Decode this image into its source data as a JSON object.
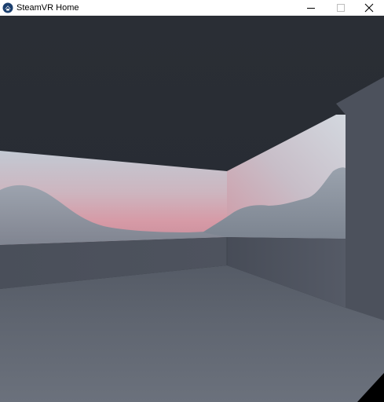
{
  "window": {
    "title": "SteamVR Home",
    "controls": {
      "minimize": "minimize-icon",
      "maximize": "maximize-icon",
      "close": "close-icon"
    }
  },
  "scene": {
    "description_icon": "steamvr-logo-icon",
    "colors": {
      "ceiling": "#2a2e35",
      "sky_top": "#b9c0cb",
      "sky_pink": "#d4a0ac",
      "mountains": "#8b939f",
      "wall": "#4d525d",
      "floor": "#5f6570"
    }
  }
}
